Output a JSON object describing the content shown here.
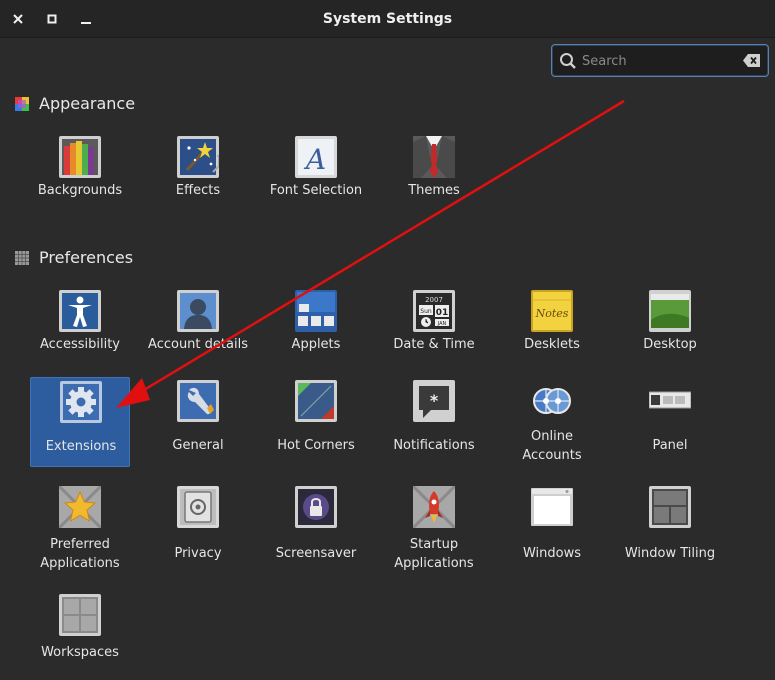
{
  "window": {
    "title": "System Settings",
    "close_glyph": "✕",
    "maximize_glyph": "□",
    "minimize_glyph": "–"
  },
  "search": {
    "placeholder": "Search",
    "value": ""
  },
  "sections": [
    {
      "label": "Appearance",
      "icon": "appearance-color-icon"
    },
    {
      "label": "Preferences",
      "icon": "preferences-grid-icon"
    }
  ],
  "appearance_items": [
    {
      "label": "Backgrounds",
      "icon": "backgrounds-icon"
    },
    {
      "label": "Effects",
      "icon": "effects-icon"
    },
    {
      "label": "Font Selection",
      "icon": "font-selection-icon"
    },
    {
      "label": "Themes",
      "icon": "themes-icon"
    }
  ],
  "preferences_items": [
    {
      "label": "Accessibility",
      "icon": "accessibility-icon"
    },
    {
      "label": "Account details",
      "icon": "account-details-icon"
    },
    {
      "label": "Applets",
      "icon": "applets-icon"
    },
    {
      "label": "Date & Time",
      "icon": "date-time-icon",
      "calendar": {
        "year": "2007",
        "day": "Sun",
        "date": "01",
        "month": "JAN"
      }
    },
    {
      "label": "Desklets",
      "icon": "desklets-icon",
      "note_text": "Notes"
    },
    {
      "label": "Desktop",
      "icon": "desktop-icon"
    },
    {
      "label": "Extensions",
      "icon": "extensions-icon",
      "selected": true
    },
    {
      "label": "General",
      "icon": "general-icon"
    },
    {
      "label": "Hot Corners",
      "icon": "hot-corners-icon"
    },
    {
      "label": "Notifications",
      "icon": "notifications-icon"
    },
    {
      "label": "Online Accounts",
      "line1": "Online",
      "line2": "Accounts",
      "icon": "online-accounts-icon"
    },
    {
      "label": "Panel",
      "icon": "panel-icon"
    },
    {
      "label": "Preferred Applications",
      "line1": "Preferred",
      "line2": "Applications",
      "icon": "preferred-applications-icon"
    },
    {
      "label": "Privacy",
      "icon": "privacy-icon"
    },
    {
      "label": "Screensaver",
      "icon": "screensaver-icon"
    },
    {
      "label": "Startup Applications",
      "line1": "Startup",
      "line2": "Applications",
      "icon": "startup-applications-icon"
    },
    {
      "label": "Windows",
      "icon": "windows-icon"
    },
    {
      "label": "Window Tiling",
      "icon": "window-tiling-icon"
    },
    {
      "label": "Workspaces",
      "icon": "workspaces-icon"
    }
  ],
  "colors": {
    "selection": "#2d5d9f",
    "annotation_arrow": "#e01010",
    "background": "#2b2b2b"
  }
}
